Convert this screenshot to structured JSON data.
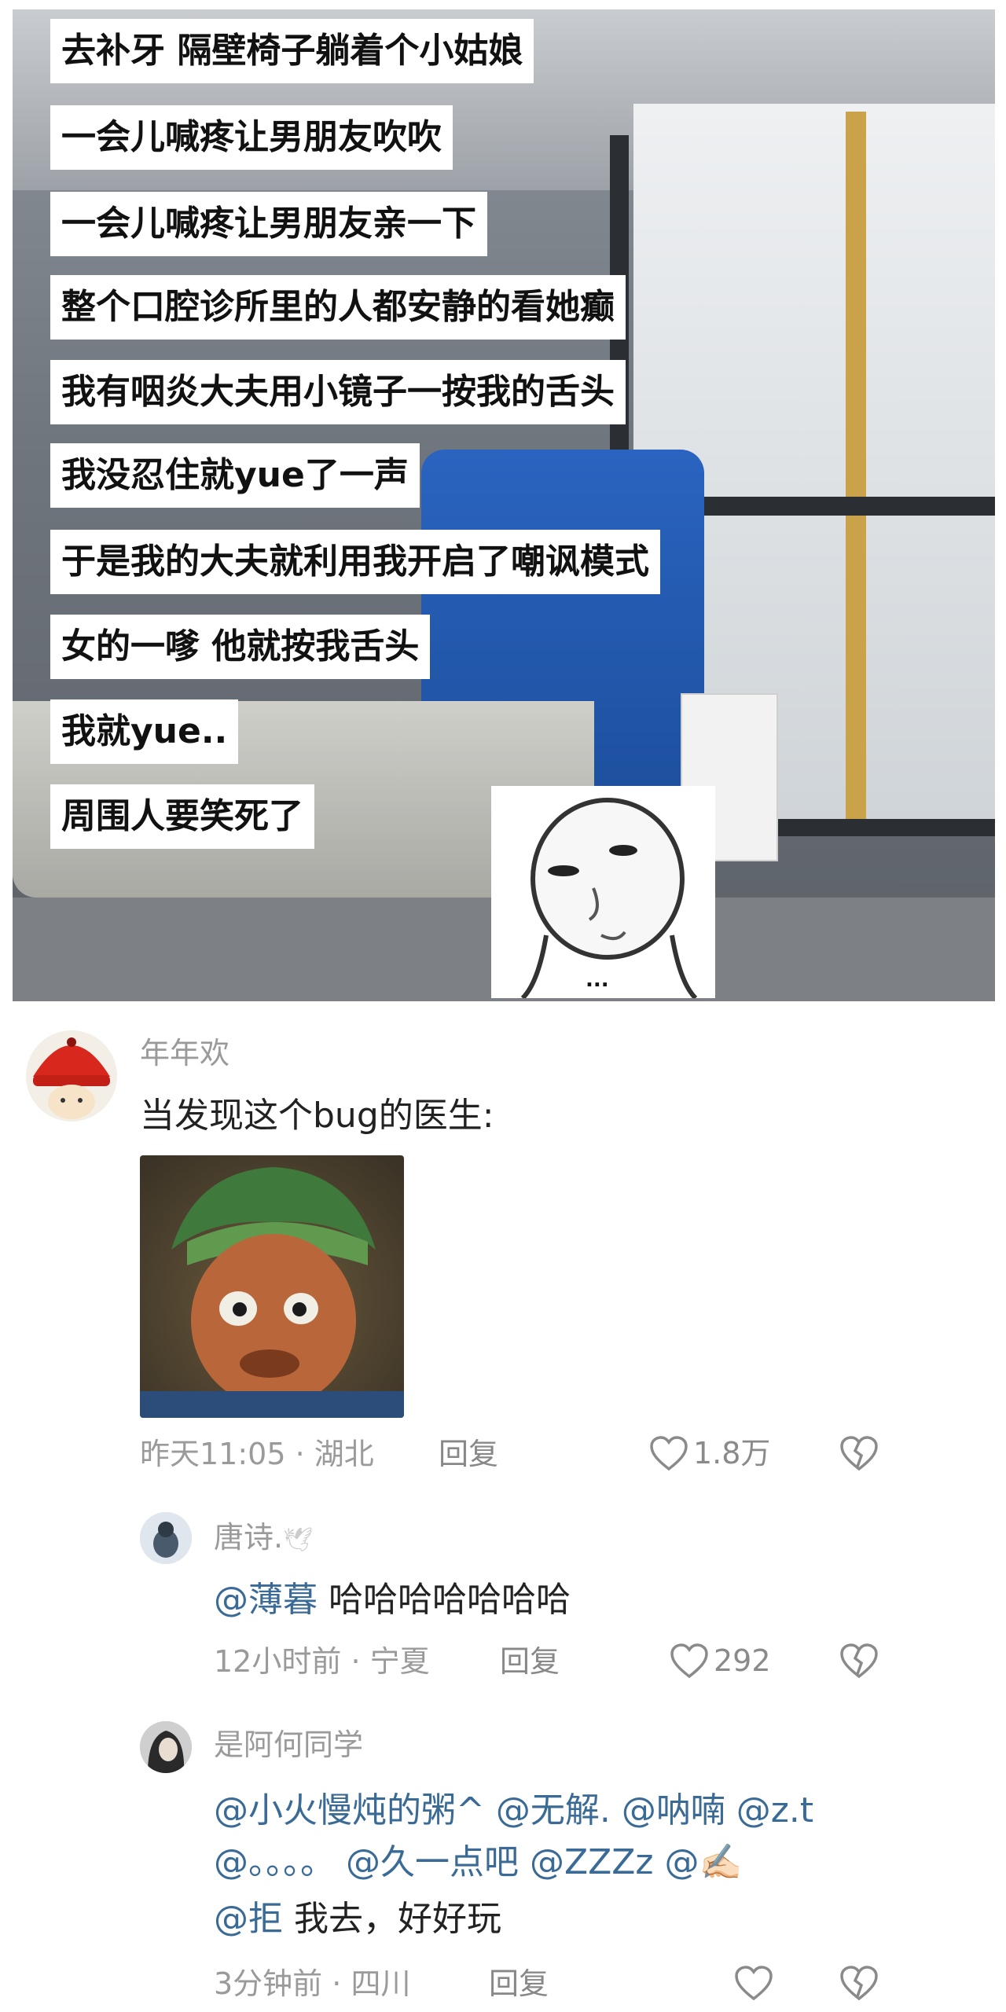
{
  "video": {
    "captions": [
      "去补牙 隔壁椅子躺着个小姑娘",
      "一会儿喊疼让男朋友吹吹",
      "一会儿喊疼让男朋友亲一下",
      "整个口腔诊所里的人都安静的看她癫",
      "我有咽炎大夫用小镜子一按我的舌头",
      "我没忍住就yue了一声",
      "于是我的大夫就利用我开启了嘲讽模式",
      "女的一嗲 他就按我舌头",
      "我就yue..",
      "周围人要笑死了"
    ],
    "meme_icon": "sticker-face-icon",
    "meme_text": "..."
  },
  "comments": {
    "main": {
      "username": "年年欢",
      "text": "当发现这个bug的医生:",
      "image_icon": "meme-image-icon",
      "time": "昨天11:05",
      "location": "湖北",
      "reply_label": "回复",
      "likes": "1.8万"
    },
    "replies": [
      {
        "username": "唐诗.",
        "username_emoji": "🕊",
        "mentions": [
          "@薄暮"
        ],
        "text_lines": [
          [
            "@薄暮",
            " 哈哈哈哈哈哈哈"
          ]
        ],
        "time": "12小时前",
        "location": "宁夏",
        "reply_label": "回复",
        "likes": "292"
      },
      {
        "username": "是阿何同学",
        "text_lines": [
          [
            "@小火慢炖的粥^ @无解. @呐喃 @z.t"
          ],
          [
            "@。。。。 @久一点吧 @ZZZz @✍🏻"
          ],
          [
            "@拒",
            " 我去，好好玩"
          ]
        ],
        "time": "3分钟前",
        "location": "四川",
        "reply_label": "回复",
        "likes": ""
      }
    ],
    "colors": {
      "mention": "#3a6a96",
      "meta": "#9a9a9a",
      "text": "#222222"
    },
    "icons": {
      "like": "heart-icon",
      "dislike": "broken-heart-icon"
    }
  }
}
